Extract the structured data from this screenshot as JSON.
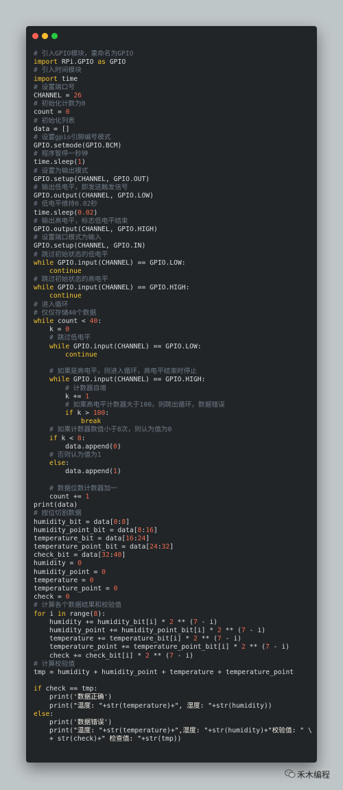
{
  "window": {
    "controls": [
      "close",
      "minimize",
      "maximize"
    ]
  },
  "code_lines": [
    {
      "indent": 0,
      "tokens": [
        [
          "comment",
          "# 引入GPIO模块，重命名为GPIO"
        ]
      ]
    },
    {
      "indent": 0,
      "tokens": [
        [
          "keyword",
          "import"
        ],
        [
          "default",
          " RPi.GPIO "
        ],
        [
          "keyword",
          "as"
        ],
        [
          "default",
          " GPIO"
        ]
      ]
    },
    {
      "indent": 0,
      "tokens": [
        [
          "comment",
          "# 引入时间模块"
        ]
      ]
    },
    {
      "indent": 0,
      "tokens": [
        [
          "keyword",
          "import"
        ],
        [
          "default",
          " time"
        ]
      ]
    },
    {
      "indent": 0,
      "tokens": [
        [
          "comment",
          "# 设置端口号"
        ]
      ]
    },
    {
      "indent": 0,
      "tokens": [
        [
          "default",
          "CHANNEL = "
        ],
        [
          "number",
          "26"
        ]
      ]
    },
    {
      "indent": 0,
      "tokens": [
        [
          "comment",
          "# 初始化计数为0"
        ]
      ]
    },
    {
      "indent": 0,
      "tokens": [
        [
          "default",
          "count = "
        ],
        [
          "number",
          "0"
        ]
      ]
    },
    {
      "indent": 0,
      "tokens": [
        [
          "comment",
          "# 初始化列表"
        ]
      ]
    },
    {
      "indent": 0,
      "tokens": [
        [
          "default",
          "data = []"
        ]
      ]
    },
    {
      "indent": 0,
      "tokens": [
        [
          "comment",
          "# 设置gpio引脚编号模式"
        ]
      ]
    },
    {
      "indent": 0,
      "tokens": [
        [
          "default",
          "GPIO.setmode(GPIO.BCM)"
        ]
      ]
    },
    {
      "indent": 0,
      "tokens": [
        [
          "comment",
          "# 程序暂停一秒钟"
        ]
      ]
    },
    {
      "indent": 0,
      "tokens": [
        [
          "default",
          "time.sleep("
        ],
        [
          "number",
          "1"
        ],
        [
          "default",
          ")"
        ]
      ]
    },
    {
      "indent": 0,
      "tokens": [
        [
          "comment",
          "# 设置为输出模式"
        ]
      ]
    },
    {
      "indent": 0,
      "tokens": [
        [
          "default",
          "GPIO.setup(CHANNEL, GPIO.OUT)"
        ]
      ]
    },
    {
      "indent": 0,
      "tokens": [
        [
          "comment",
          "# 输出低电平，即发送触发信号"
        ]
      ]
    },
    {
      "indent": 0,
      "tokens": [
        [
          "default",
          "GPIO.output(CHANNEL, GPIO.LOW)"
        ]
      ]
    },
    {
      "indent": 0,
      "tokens": [
        [
          "comment",
          "# 低电平维持0.02秒"
        ]
      ]
    },
    {
      "indent": 0,
      "tokens": [
        [
          "default",
          "time.sleep("
        ],
        [
          "number",
          "0.02"
        ],
        [
          "default",
          ")"
        ]
      ]
    },
    {
      "indent": 0,
      "tokens": [
        [
          "comment",
          "# 输出高电平，标志低电平结束"
        ]
      ]
    },
    {
      "indent": 0,
      "tokens": [
        [
          "default",
          "GPIO.output(CHANNEL, GPIO.HIGH)"
        ]
      ]
    },
    {
      "indent": 0,
      "tokens": [
        [
          "comment",
          "# 设置端口模式为输入"
        ]
      ]
    },
    {
      "indent": 0,
      "tokens": [
        [
          "default",
          "GPIO.setup(CHANNEL, GPIO.IN)"
        ]
      ]
    },
    {
      "indent": 0,
      "tokens": [
        [
          "comment",
          "# 跳过初始状态的低电平"
        ]
      ]
    },
    {
      "indent": 0,
      "tokens": [
        [
          "keyword",
          "while"
        ],
        [
          "default",
          " GPIO.input(CHANNEL) == GPIO.LOW:"
        ]
      ]
    },
    {
      "indent": 1,
      "tokens": [
        [
          "keyword",
          "continue"
        ]
      ]
    },
    {
      "indent": 0,
      "tokens": [
        [
          "comment",
          "# 跳过初始状态的高电平"
        ]
      ]
    },
    {
      "indent": 0,
      "tokens": [
        [
          "keyword",
          "while"
        ],
        [
          "default",
          " GPIO.input(CHANNEL) == GPIO.HIGH:"
        ]
      ]
    },
    {
      "indent": 1,
      "tokens": [
        [
          "keyword",
          "continue"
        ]
      ]
    },
    {
      "indent": 0,
      "tokens": [
        [
          "comment",
          "# 进入循环"
        ]
      ]
    },
    {
      "indent": 0,
      "tokens": [
        [
          "comment",
          "# 仅仅存储40个数据"
        ]
      ]
    },
    {
      "indent": 0,
      "tokens": [
        [
          "keyword",
          "while"
        ],
        [
          "default",
          " count < "
        ],
        [
          "number",
          "40"
        ],
        [
          "default",
          ":"
        ]
      ]
    },
    {
      "indent": 1,
      "tokens": [
        [
          "default",
          "k = "
        ],
        [
          "number",
          "0"
        ]
      ]
    },
    {
      "indent": 1,
      "tokens": [
        [
          "comment",
          "# 跳过低电平"
        ]
      ]
    },
    {
      "indent": 1,
      "tokens": [
        [
          "keyword",
          "while"
        ],
        [
          "default",
          " GPIO.input(CHANNEL) == GPIO.LOW:"
        ]
      ]
    },
    {
      "indent": 2,
      "tokens": [
        [
          "keyword",
          "continue"
        ]
      ]
    },
    {
      "indent": 0,
      "tokens": []
    },
    {
      "indent": 1,
      "tokens": [
        [
          "comment",
          "# 如果是高电平，则进入循环，高电平结束时停止"
        ]
      ]
    },
    {
      "indent": 1,
      "tokens": [
        [
          "keyword",
          "while"
        ],
        [
          "default",
          " GPIO.input(CHANNEL) == GPIO.HIGH:"
        ]
      ]
    },
    {
      "indent": 2,
      "tokens": [
        [
          "comment",
          "# 计数器自增"
        ]
      ]
    },
    {
      "indent": 2,
      "tokens": [
        [
          "default",
          "k += "
        ],
        [
          "number",
          "1"
        ]
      ]
    },
    {
      "indent": 2,
      "tokens": [
        [
          "comment",
          "# 如果高电平计数器大于100，则跳出循环，数据错误"
        ]
      ]
    },
    {
      "indent": 2,
      "tokens": [
        [
          "keyword",
          "if"
        ],
        [
          "default",
          " k > "
        ],
        [
          "number",
          "100"
        ],
        [
          "default",
          ":"
        ]
      ]
    },
    {
      "indent": 3,
      "tokens": [
        [
          "keyword",
          "break"
        ]
      ]
    },
    {
      "indent": 1,
      "tokens": [
        [
          "comment",
          "# 如果计数器数值小于8次，则认为值为0"
        ]
      ]
    },
    {
      "indent": 1,
      "tokens": [
        [
          "keyword",
          "if"
        ],
        [
          "default",
          " k < "
        ],
        [
          "number",
          "8"
        ],
        [
          "default",
          ":"
        ]
      ]
    },
    {
      "indent": 2,
      "tokens": [
        [
          "default",
          "data.append("
        ],
        [
          "number",
          "0"
        ],
        [
          "default",
          ")"
        ]
      ]
    },
    {
      "indent": 1,
      "tokens": [
        [
          "comment",
          "# 否则认为值为1"
        ]
      ]
    },
    {
      "indent": 1,
      "tokens": [
        [
          "keyword",
          "else"
        ],
        [
          "default",
          ":"
        ]
      ]
    },
    {
      "indent": 2,
      "tokens": [
        [
          "default",
          "data.append("
        ],
        [
          "number",
          "1"
        ],
        [
          "default",
          ")"
        ]
      ]
    },
    {
      "indent": 0,
      "tokens": []
    },
    {
      "indent": 1,
      "tokens": [
        [
          "comment",
          "# 数据位数计数器加一"
        ]
      ]
    },
    {
      "indent": 1,
      "tokens": [
        [
          "default",
          "count += "
        ],
        [
          "number",
          "1"
        ]
      ]
    },
    {
      "indent": 0,
      "tokens": [
        [
          "default",
          "print(data)"
        ]
      ]
    },
    {
      "indent": 0,
      "tokens": [
        [
          "comment",
          "# 按位切割数据"
        ]
      ]
    },
    {
      "indent": 0,
      "tokens": [
        [
          "default",
          "humidity_bit = data["
        ],
        [
          "number",
          "0"
        ],
        [
          "default",
          ":"
        ],
        [
          "number",
          "8"
        ],
        [
          "default",
          "]"
        ]
      ]
    },
    {
      "indent": 0,
      "tokens": [
        [
          "default",
          "humidity_point_bit = data["
        ],
        [
          "number",
          "8"
        ],
        [
          "default",
          ":"
        ],
        [
          "number",
          "16"
        ],
        [
          "default",
          "]"
        ]
      ]
    },
    {
      "indent": 0,
      "tokens": [
        [
          "default",
          "temperature_bit = data["
        ],
        [
          "number",
          "16"
        ],
        [
          "default",
          ":"
        ],
        [
          "number",
          "24"
        ],
        [
          "default",
          "]"
        ]
      ]
    },
    {
      "indent": 0,
      "tokens": [
        [
          "default",
          "temperature_point_bit = data["
        ],
        [
          "number",
          "24"
        ],
        [
          "default",
          ":"
        ],
        [
          "number",
          "32"
        ],
        [
          "default",
          "]"
        ]
      ]
    },
    {
      "indent": 0,
      "tokens": [
        [
          "default",
          "check_bit = data["
        ],
        [
          "number",
          "32"
        ],
        [
          "default",
          ":"
        ],
        [
          "number",
          "40"
        ],
        [
          "default",
          "]"
        ]
      ]
    },
    {
      "indent": 0,
      "tokens": [
        [
          "default",
          "humidity = "
        ],
        [
          "number",
          "0"
        ]
      ]
    },
    {
      "indent": 0,
      "tokens": [
        [
          "default",
          "humidity_point = "
        ],
        [
          "number",
          "0"
        ]
      ]
    },
    {
      "indent": 0,
      "tokens": [
        [
          "default",
          "temperature = "
        ],
        [
          "number",
          "0"
        ]
      ]
    },
    {
      "indent": 0,
      "tokens": [
        [
          "default",
          "temperature_point = "
        ],
        [
          "number",
          "0"
        ]
      ]
    },
    {
      "indent": 0,
      "tokens": [
        [
          "default",
          "check = "
        ],
        [
          "number",
          "0"
        ]
      ]
    },
    {
      "indent": 0,
      "tokens": [
        [
          "comment",
          "# 计算各个数据结果和校验值"
        ]
      ]
    },
    {
      "indent": 0,
      "tokens": [
        [
          "keyword",
          "for"
        ],
        [
          "default",
          " i "
        ],
        [
          "keyword",
          "in"
        ],
        [
          "default",
          " range("
        ],
        [
          "number",
          "8"
        ],
        [
          "default",
          "):"
        ]
      ]
    },
    {
      "indent": 1,
      "tokens": [
        [
          "default",
          "humidity += humidity_bit[i] * "
        ],
        [
          "number",
          "2"
        ],
        [
          "default",
          " ** ("
        ],
        [
          "number",
          "7"
        ],
        [
          "default",
          " - i)"
        ]
      ]
    },
    {
      "indent": 1,
      "tokens": [
        [
          "default",
          "humidity_point += humidity_point_bit[i] * "
        ],
        [
          "number",
          "2"
        ],
        [
          "default",
          " ** ("
        ],
        [
          "number",
          "7"
        ],
        [
          "default",
          " - i)"
        ]
      ]
    },
    {
      "indent": 1,
      "tokens": [
        [
          "default",
          "temperature += temperature_bit[i] * "
        ],
        [
          "number",
          "2"
        ],
        [
          "default",
          " ** ("
        ],
        [
          "number",
          "7"
        ],
        [
          "default",
          " - i)"
        ]
      ]
    },
    {
      "indent": 1,
      "tokens": [
        [
          "default",
          "temperature_point += temperature_point_bit[i] * "
        ],
        [
          "number",
          "2"
        ],
        [
          "default",
          " ** ("
        ],
        [
          "number",
          "7"
        ],
        [
          "default",
          " - i)"
        ]
      ]
    },
    {
      "indent": 1,
      "tokens": [
        [
          "default",
          "check += check_bit[i] * "
        ],
        [
          "number",
          "2"
        ],
        [
          "default",
          " ** ("
        ],
        [
          "number",
          "7"
        ],
        [
          "default",
          " - i)"
        ]
      ]
    },
    {
      "indent": 0,
      "tokens": [
        [
          "comment",
          "# 计算校验值"
        ]
      ]
    },
    {
      "indent": 0,
      "tokens": [
        [
          "default",
          "tmp = humidity + humidity_point + temperature + temperature_point"
        ]
      ]
    },
    {
      "indent": 0,
      "tokens": []
    },
    {
      "indent": 0,
      "tokens": [
        [
          "keyword",
          "if"
        ],
        [
          "default",
          " check == tmp:"
        ]
      ]
    },
    {
      "indent": 1,
      "tokens": [
        [
          "default",
          "print("
        ],
        [
          "string",
          "'数据正确'"
        ],
        [
          "default",
          ")"
        ]
      ]
    },
    {
      "indent": 1,
      "tokens": [
        [
          "default",
          "print("
        ],
        [
          "string",
          "\"温度: \""
        ],
        [
          "default",
          "+str(temperature)+"
        ],
        [
          "string",
          "\", 湿度: \""
        ],
        [
          "default",
          "+str(humidity))"
        ]
      ]
    },
    {
      "indent": 0,
      "tokens": [
        [
          "keyword",
          "else"
        ],
        [
          "default",
          ":"
        ]
      ]
    },
    {
      "indent": 1,
      "tokens": [
        [
          "default",
          "print("
        ],
        [
          "string",
          "'数据错误'"
        ],
        [
          "default",
          ")"
        ]
      ]
    },
    {
      "indent": 1,
      "tokens": [
        [
          "default",
          "print("
        ],
        [
          "string",
          "\"温度: \""
        ],
        [
          "default",
          "+str(temperature)+"
        ],
        [
          "string",
          "\",湿度: \""
        ],
        [
          "default",
          "+str(humidity)+"
        ],
        [
          "string",
          "\"校验值: \""
        ],
        [
          "default",
          " \\"
        ]
      ]
    },
    {
      "indent": 1,
      "tokens": [
        [
          "default",
          "+ str(check)+"
        ],
        [
          "string",
          "\" 检查值: \""
        ],
        [
          "default",
          "+str(tmp))"
        ]
      ]
    }
  ],
  "watermark": {
    "text": "禾木编程",
    "icon": "wechat-icon"
  }
}
